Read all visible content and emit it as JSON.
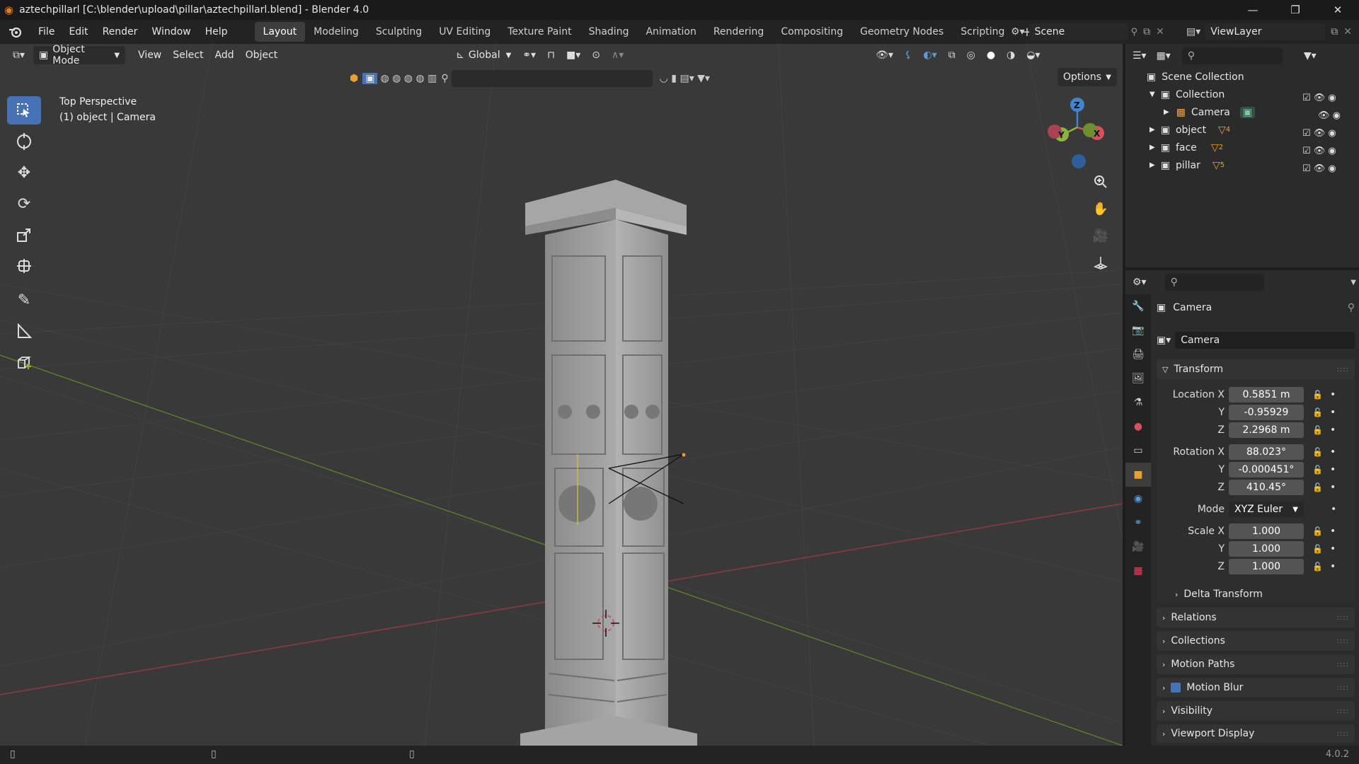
{
  "window": {
    "title": "aztechpillarl [C:\\blender\\upload\\pillar\\aztechpillarl.blend] - Blender 4.0",
    "minimize": "—",
    "maximize": "❐",
    "close": "✕"
  },
  "menubar": {
    "items": [
      "File",
      "Edit",
      "Render",
      "Window",
      "Help"
    ]
  },
  "workspaces": {
    "tabs": [
      "Layout",
      "Modeling",
      "Sculpting",
      "UV Editing",
      "Texture Paint",
      "Shading",
      "Animation",
      "Rendering",
      "Compositing",
      "Geometry Nodes",
      "Scripting"
    ],
    "active": "Layout",
    "add": "+"
  },
  "scene": {
    "name": "Scene",
    "view_layer": "ViewLayer"
  },
  "viewport_header": {
    "mode": "Object Mode",
    "menus": [
      "View",
      "Select",
      "Add",
      "Object"
    ],
    "transform_orientation": "Global",
    "options": "Options"
  },
  "viewport": {
    "view_name": "Top Perspective",
    "active_object": "(1) object | Camera",
    "gizmo_axes": {
      "x": "X",
      "y": "Y",
      "z": "Z"
    }
  },
  "outliner": {
    "root": "Scene Collection",
    "rows": [
      {
        "name": "Collection",
        "badge": ""
      },
      {
        "name": "Camera",
        "badge": ""
      },
      {
        "name": "object",
        "badge": "4"
      },
      {
        "name": "face",
        "badge": "2"
      },
      {
        "name": "pillar",
        "badge": "5"
      }
    ]
  },
  "properties": {
    "object_name": "Camera",
    "data_name": "Camera",
    "transform_label": "Transform",
    "location": {
      "label": "Location X",
      "x": "0.5851 m",
      "y": "-0.95929",
      "z": "2.2968 m"
    },
    "rotation": {
      "label": "Rotation X",
      "x": "88.023°",
      "y": "-0.000451°",
      "z": "410.45°"
    },
    "mode": {
      "label": "Mode",
      "value": "XYZ Euler"
    },
    "scale": {
      "label": "Scale X",
      "x": "1.000",
      "y": "1.000",
      "z": "1.000"
    },
    "axis_y": "Y",
    "axis_z": "Z",
    "delta": "Delta Transform",
    "sections": [
      "Relations",
      "Collections",
      "Motion Paths",
      "Motion Blur",
      "Visibility",
      "Viewport Display"
    ]
  },
  "statusbar": {
    "version": "4.0.2"
  },
  "colors": {
    "accent": "#4772b3",
    "x_axis": "#d84f5e",
    "y_axis": "#8ab43c",
    "z_axis": "#3f86d1"
  }
}
